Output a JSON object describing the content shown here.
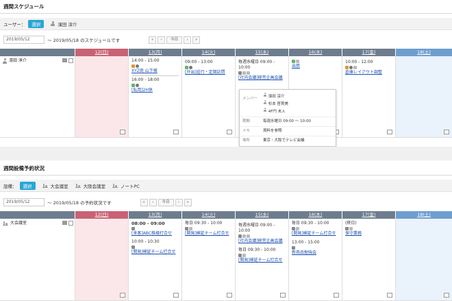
{
  "weekly_schedule": {
    "title": "週間スケジュール",
    "user_label": "ユーザー：",
    "select_button": "選択",
    "selected_user": "濱田 淳介",
    "date_value": "2019/05/12",
    "date_range_text": "～ 2019/05/18 のスケジュールです",
    "nav": [
      "«",
      "‹",
      "今日",
      "›",
      "»"
    ],
    "days": [
      "12(日)",
      "13(月)",
      "14(火)",
      "15(水)",
      "16(木)",
      "17(金)",
      "18(土)"
    ],
    "row_user": "濱田 淳介",
    "events": {
      "mon": [
        {
          "time": "14:00 - 15:00",
          "title": "XYZ商 山下様"
        },
        {
          "time": "16:00 - 18:00",
          "title": "[私用]2H休"
        }
      ],
      "tue": [
        {
          "time": "09:00 - 13:00",
          "title": "[外出]巡行・定期訪問"
        }
      ],
      "wed": [
        {
          "time": "毎週水曜日 09:00 - 10:00",
          "title": "[社内会議]経営企画会議"
        }
      ],
      "thu": [
        {
          "title": "出張"
        }
      ],
      "fri": [
        {
          "time": "10:00 - 12:00",
          "title": "倉庫レイアウト調整"
        }
      ]
    },
    "tooltip": {
      "member_label": "メンバー",
      "members": [
        "濱田 淳介",
        "杉本 啓貫美",
        "4F円 未入"
      ],
      "period_label": "期間",
      "period": "毎週水曜日 09:00 ～ 10:00",
      "memo_label": "メモ",
      "memo": "資料を参照",
      "place_label": "場所",
      "place": "東京・大阪でテレビ会議"
    }
  },
  "weekly_facility": {
    "title": "週間設備予約状況",
    "facility_label": "設備：",
    "select_button": "選択",
    "facilities": [
      "大会議室",
      "大阪会議室",
      "ノートPC"
    ],
    "date_value": "2019/05/12",
    "date_range_text": "～ 2019/05/18 の予約状況です",
    "nav": [
      "«",
      "‹",
      "今日",
      "›",
      "»"
    ],
    "days": [
      "12(日)",
      "13(月)",
      "14(火)",
      "15(水)",
      "16(木)",
      "17(金)",
      "18(土)"
    ],
    "row_facility": "大会議室",
    "events": {
      "mon": [
        {
          "time": "08:00 - 09:00",
          "title": "[来客]ABC株様打合せ"
        },
        {
          "time": "10:00 - 10:30",
          "title": "[開発]検証チーム打合せ"
        }
      ],
      "tue": [
        {
          "time": "毎日 09:30 - 10:00",
          "title": "[開発]検証チーム打合せ"
        }
      ],
      "wed": [
        {
          "time": "毎週水曜日 09:00 - 10:00",
          "title": "[社内会議]経営企画会議"
        },
        {
          "time": "毎日 09:30 - 10:00",
          "title": "[開発]検証チーム打合せ"
        }
      ],
      "thu": [
        {
          "time": "毎日 09:30 - 10:00",
          "title": "[開発]検証チーム打合せ"
        },
        {
          "time": "13:00 - 15:00",
          "title": "新商品勉強会"
        }
      ],
      "fri": [
        {
          "time": "(終日)",
          "title": "保守業務"
        }
      ]
    }
  }
}
